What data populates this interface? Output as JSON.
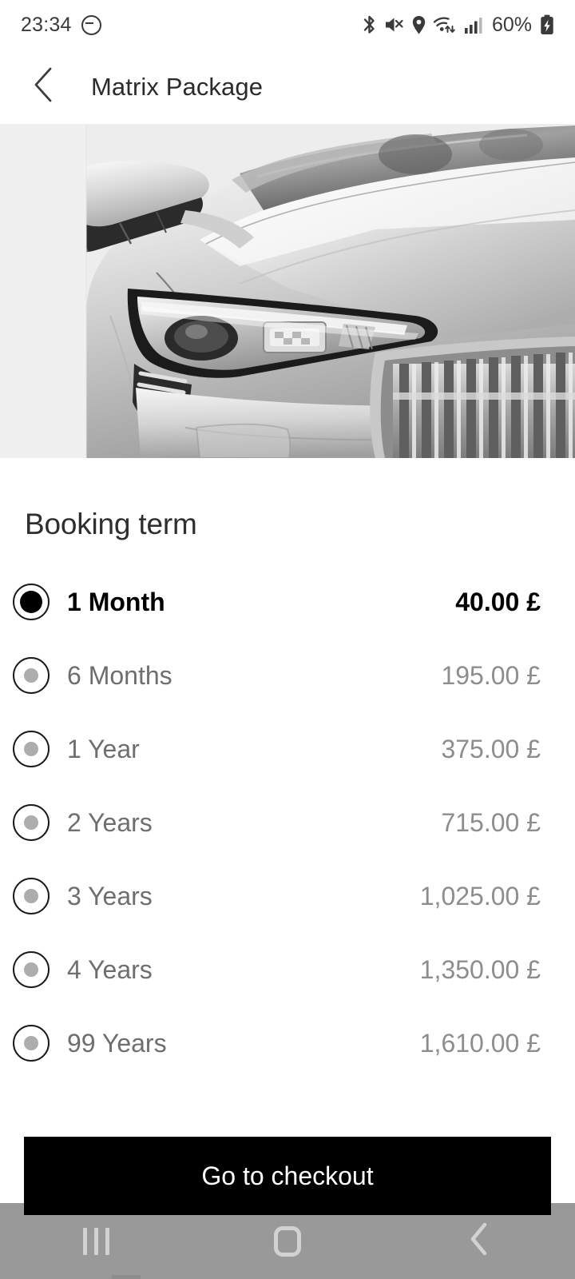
{
  "status_bar": {
    "time": "23:34",
    "battery_percent": "60%",
    "icons": [
      "do-not-disturb-icon",
      "bluetooth-icon",
      "mute-icon",
      "location-icon",
      "wifi-icon",
      "signal-icon",
      "battery-charging-icon"
    ]
  },
  "header": {
    "title": "Matrix Package",
    "back_icon": "chevron-left-icon"
  },
  "hero": {
    "alt": "silver car front headlight and grille",
    "background_color": "#eeeeee"
  },
  "main": {
    "section_heading": "Booking term",
    "options": [
      {
        "label": "1 Month",
        "price": "40.00 £",
        "selected": true
      },
      {
        "label": "6 Months",
        "price": "195.00 £",
        "selected": false
      },
      {
        "label": "1 Year",
        "price": "375.00 £",
        "selected": false
      },
      {
        "label": "2 Years",
        "price": "715.00 £",
        "selected": false
      },
      {
        "label": "3 Years",
        "price": "1,025.00 £",
        "selected": false
      },
      {
        "label": "4 Years",
        "price": "1,350.00 £",
        "selected": false
      },
      {
        "label": "99 Years",
        "price": "1,610.00 £",
        "selected": false
      }
    ]
  },
  "checkout": {
    "label": "Go to checkout",
    "background_color": "#000000",
    "text_color": "#ffffff"
  },
  "nav_bar": {
    "background_color": "#999999",
    "items": [
      {
        "name": "recents-icon"
      },
      {
        "name": "home-icon"
      },
      {
        "name": "back-icon"
      }
    ]
  },
  "colors": {
    "selected_text": "#000000",
    "unselected_label": "#6e6e6e",
    "unselected_price": "#8d8d8d",
    "title": "#2b2b2b"
  }
}
